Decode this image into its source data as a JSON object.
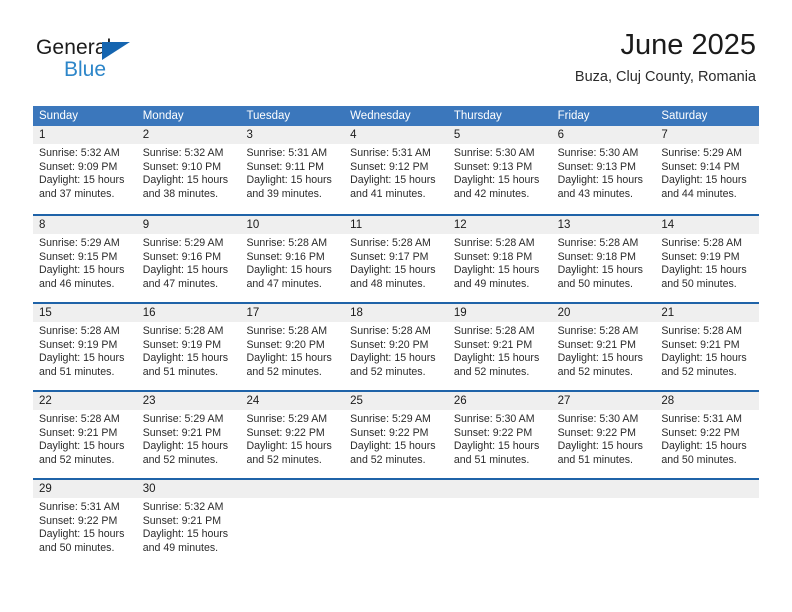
{
  "brand": {
    "name_dark": "General",
    "name_blue": "Blue",
    "triangle_color": "#1565b0",
    "blue_color": "#2d86c9"
  },
  "header": {
    "month_title": "June 2025",
    "location": "Buza, Cluj County, Romania"
  },
  "theme": {
    "header_bg": "#3b77bc",
    "row_divider": "#1f63a8",
    "daynum_bg": "#efefef"
  },
  "calendar": {
    "weekdays": [
      "Sunday",
      "Monday",
      "Tuesday",
      "Wednesday",
      "Thursday",
      "Friday",
      "Saturday"
    ],
    "weeks": [
      [
        {
          "day": "1",
          "l1": "Sunrise: 5:32 AM",
          "l2": "Sunset: 9:09 PM",
          "l3": "Daylight: 15 hours",
          "l4": "and 37 minutes."
        },
        {
          "day": "2",
          "l1": "Sunrise: 5:32 AM",
          "l2": "Sunset: 9:10 PM",
          "l3": "Daylight: 15 hours",
          "l4": "and 38 minutes."
        },
        {
          "day": "3",
          "l1": "Sunrise: 5:31 AM",
          "l2": "Sunset: 9:11 PM",
          "l3": "Daylight: 15 hours",
          "l4": "and 39 minutes."
        },
        {
          "day": "4",
          "l1": "Sunrise: 5:31 AM",
          "l2": "Sunset: 9:12 PM",
          "l3": "Daylight: 15 hours",
          "l4": "and 41 minutes."
        },
        {
          "day": "5",
          "l1": "Sunrise: 5:30 AM",
          "l2": "Sunset: 9:13 PM",
          "l3": "Daylight: 15 hours",
          "l4": "and 42 minutes."
        },
        {
          "day": "6",
          "l1": "Sunrise: 5:30 AM",
          "l2": "Sunset: 9:13 PM",
          "l3": "Daylight: 15 hours",
          "l4": "and 43 minutes."
        },
        {
          "day": "7",
          "l1": "Sunrise: 5:29 AM",
          "l2": "Sunset: 9:14 PM",
          "l3": "Daylight: 15 hours",
          "l4": "and 44 minutes."
        }
      ],
      [
        {
          "day": "8",
          "l1": "Sunrise: 5:29 AM",
          "l2": "Sunset: 9:15 PM",
          "l3": "Daylight: 15 hours",
          "l4": "and 46 minutes."
        },
        {
          "day": "9",
          "l1": "Sunrise: 5:29 AM",
          "l2": "Sunset: 9:16 PM",
          "l3": "Daylight: 15 hours",
          "l4": "and 47 minutes."
        },
        {
          "day": "10",
          "l1": "Sunrise: 5:28 AM",
          "l2": "Sunset: 9:16 PM",
          "l3": "Daylight: 15 hours",
          "l4": "and 47 minutes."
        },
        {
          "day": "11",
          "l1": "Sunrise: 5:28 AM",
          "l2": "Sunset: 9:17 PM",
          "l3": "Daylight: 15 hours",
          "l4": "and 48 minutes."
        },
        {
          "day": "12",
          "l1": "Sunrise: 5:28 AM",
          "l2": "Sunset: 9:18 PM",
          "l3": "Daylight: 15 hours",
          "l4": "and 49 minutes."
        },
        {
          "day": "13",
          "l1": "Sunrise: 5:28 AM",
          "l2": "Sunset: 9:18 PM",
          "l3": "Daylight: 15 hours",
          "l4": "and 50 minutes."
        },
        {
          "day": "14",
          "l1": "Sunrise: 5:28 AM",
          "l2": "Sunset: 9:19 PM",
          "l3": "Daylight: 15 hours",
          "l4": "and 50 minutes."
        }
      ],
      [
        {
          "day": "15",
          "l1": "Sunrise: 5:28 AM",
          "l2": "Sunset: 9:19 PM",
          "l3": "Daylight: 15 hours",
          "l4": "and 51 minutes."
        },
        {
          "day": "16",
          "l1": "Sunrise: 5:28 AM",
          "l2": "Sunset: 9:19 PM",
          "l3": "Daylight: 15 hours",
          "l4": "and 51 minutes."
        },
        {
          "day": "17",
          "l1": "Sunrise: 5:28 AM",
          "l2": "Sunset: 9:20 PM",
          "l3": "Daylight: 15 hours",
          "l4": "and 52 minutes."
        },
        {
          "day": "18",
          "l1": "Sunrise: 5:28 AM",
          "l2": "Sunset: 9:20 PM",
          "l3": "Daylight: 15 hours",
          "l4": "and 52 minutes."
        },
        {
          "day": "19",
          "l1": "Sunrise: 5:28 AM",
          "l2": "Sunset: 9:21 PM",
          "l3": "Daylight: 15 hours",
          "l4": "and 52 minutes."
        },
        {
          "day": "20",
          "l1": "Sunrise: 5:28 AM",
          "l2": "Sunset: 9:21 PM",
          "l3": "Daylight: 15 hours",
          "l4": "and 52 minutes."
        },
        {
          "day": "21",
          "l1": "Sunrise: 5:28 AM",
          "l2": "Sunset: 9:21 PM",
          "l3": "Daylight: 15 hours",
          "l4": "and 52 minutes."
        }
      ],
      [
        {
          "day": "22",
          "l1": "Sunrise: 5:28 AM",
          "l2": "Sunset: 9:21 PM",
          "l3": "Daylight: 15 hours",
          "l4": "and 52 minutes."
        },
        {
          "day": "23",
          "l1": "Sunrise: 5:29 AM",
          "l2": "Sunset: 9:21 PM",
          "l3": "Daylight: 15 hours",
          "l4": "and 52 minutes."
        },
        {
          "day": "24",
          "l1": "Sunrise: 5:29 AM",
          "l2": "Sunset: 9:22 PM",
          "l3": "Daylight: 15 hours",
          "l4": "and 52 minutes."
        },
        {
          "day": "25",
          "l1": "Sunrise: 5:29 AM",
          "l2": "Sunset: 9:22 PM",
          "l3": "Daylight: 15 hours",
          "l4": "and 52 minutes."
        },
        {
          "day": "26",
          "l1": "Sunrise: 5:30 AM",
          "l2": "Sunset: 9:22 PM",
          "l3": "Daylight: 15 hours",
          "l4": "and 51 minutes."
        },
        {
          "day": "27",
          "l1": "Sunrise: 5:30 AM",
          "l2": "Sunset: 9:22 PM",
          "l3": "Daylight: 15 hours",
          "l4": "and 51 minutes."
        },
        {
          "day": "28",
          "l1": "Sunrise: 5:31 AM",
          "l2": "Sunset: 9:22 PM",
          "l3": "Daylight: 15 hours",
          "l4": "and 50 minutes."
        }
      ],
      [
        {
          "day": "29",
          "l1": "Sunrise: 5:31 AM",
          "l2": "Sunset: 9:22 PM",
          "l3": "Daylight: 15 hours",
          "l4": "and 50 minutes."
        },
        {
          "day": "30",
          "l1": "Sunrise: 5:32 AM",
          "l2": "Sunset: 9:21 PM",
          "l3": "Daylight: 15 hours",
          "l4": "and 49 minutes."
        },
        {
          "day": "",
          "l1": "",
          "l2": "",
          "l3": "",
          "l4": ""
        },
        {
          "day": "",
          "l1": "",
          "l2": "",
          "l3": "",
          "l4": ""
        },
        {
          "day": "",
          "l1": "",
          "l2": "",
          "l3": "",
          "l4": ""
        },
        {
          "day": "",
          "l1": "",
          "l2": "",
          "l3": "",
          "l4": ""
        },
        {
          "day": "",
          "l1": "",
          "l2": "",
          "l3": "",
          "l4": ""
        }
      ]
    ]
  }
}
